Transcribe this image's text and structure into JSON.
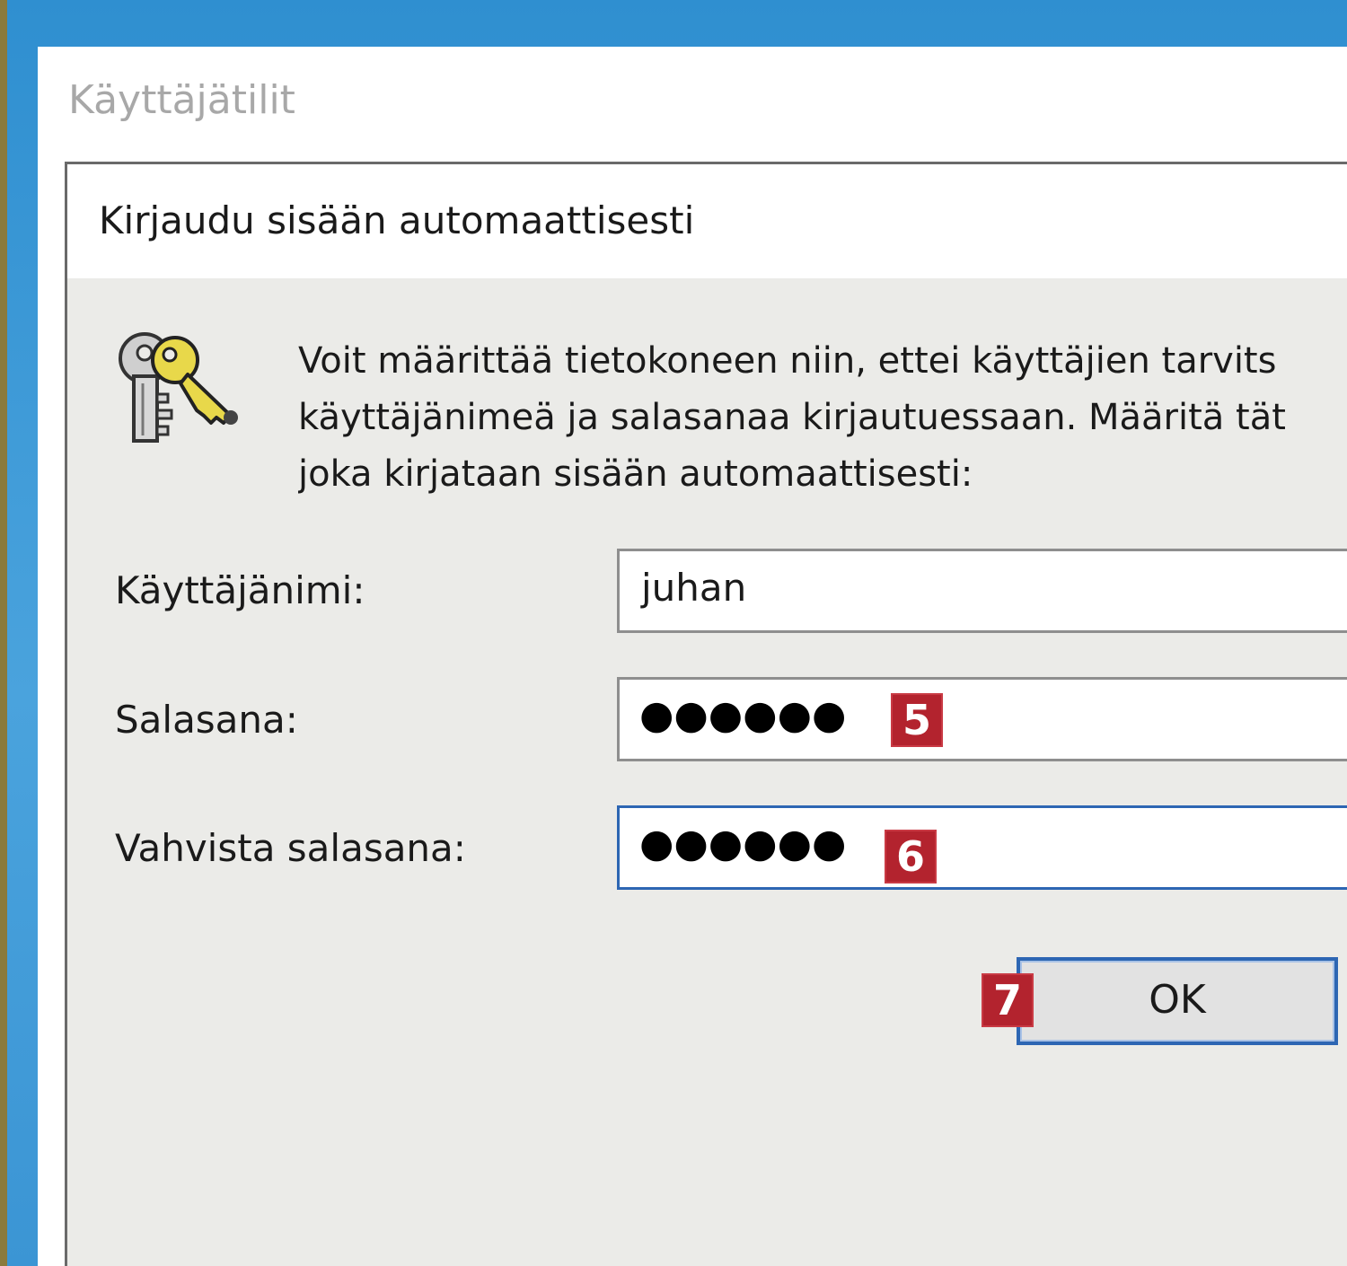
{
  "window": {
    "title": "Käyttäjätilit"
  },
  "dialog": {
    "title": "Kirjaudu sisään automaattisesti",
    "description_lines": [
      "Voit määrittää tietokoneen niin, ettei käyttäjien tarvits",
      "käyttäjänimeä ja salasanaa kirjautuessaan. Määritä tät",
      "joka kirjataan sisään automaattisesti:"
    ],
    "icon": "keys-icon"
  },
  "form": {
    "username": {
      "label": "Käyttäjänimi:",
      "value": "juhan"
    },
    "password": {
      "label": "Salasana:",
      "masked_value": "●●●●●●"
    },
    "confirm_password": {
      "label": "Vahvista salasana:",
      "masked_value": "●●●●●●"
    }
  },
  "buttons": {
    "ok_label": "OK"
  },
  "annotations": {
    "step_5": "5",
    "step_6": "6",
    "step_7": "7",
    "badge_color": "#b3232e"
  },
  "colors": {
    "desktop": "#3f9ad4",
    "dialog_bg": "#ebebe8",
    "focus_border": "#2d66b3"
  }
}
